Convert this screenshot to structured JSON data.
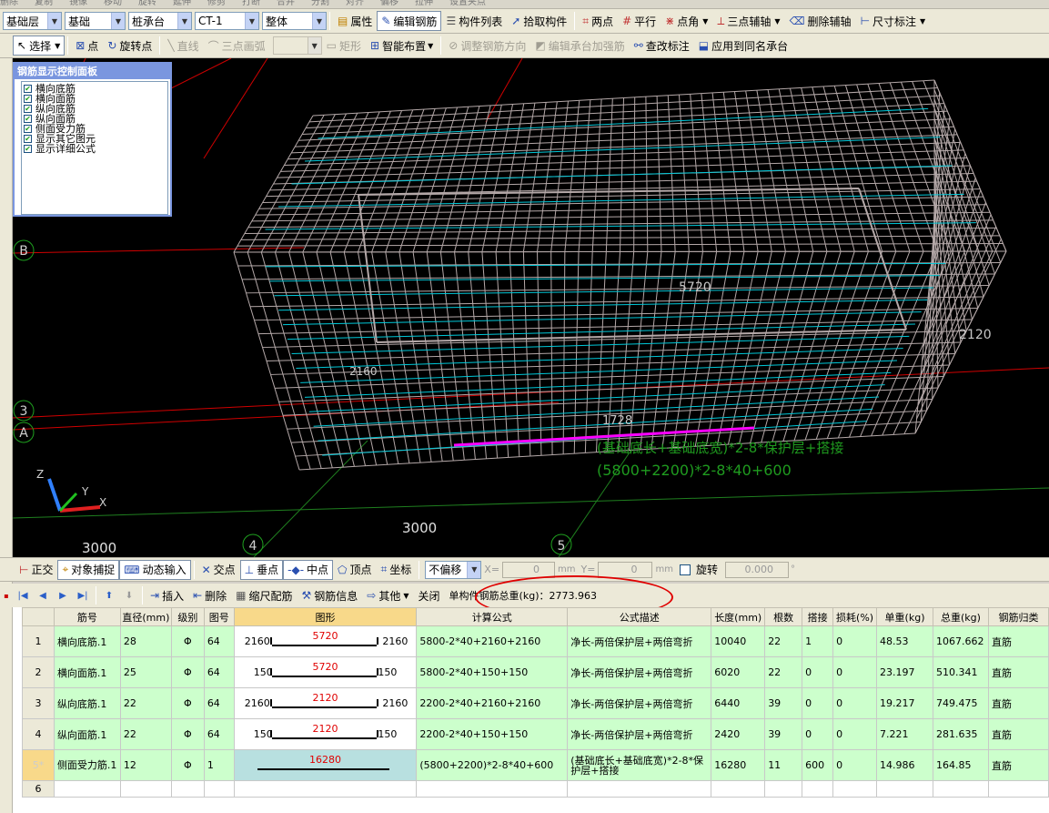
{
  "top_strip": [
    "删除",
    "复制",
    "镜像",
    "移动",
    "旋转",
    "延伸",
    "修剪",
    "打断",
    "合并",
    "分割",
    "对齐",
    "偏移",
    "拉伸",
    "设置夹点"
  ],
  "toolbar1": {
    "floor_select": "基础层",
    "category_select": "基础",
    "type_select": "桩承台",
    "element_select": "CT-1",
    "unit_select": "整体",
    "properties": "属性",
    "edit_rebar": "编辑钢筋",
    "element_list": "构件列表",
    "pick_element": "拾取构件",
    "two_points": "两点",
    "parallel": "平行",
    "point_angle": "点角",
    "three_point_axis": "三点辅轴",
    "delete_aux": "删除辅轴",
    "dimension": "尺寸标注"
  },
  "toolbar2": {
    "select": "选择",
    "point": "点",
    "rotate_point": "旋转点",
    "line": "直线",
    "arc3": "三点画弧",
    "rect": "矩形",
    "smart_layout": "智能布置",
    "adjust_direction": "调整钢筋方向",
    "edit_reinforce": "编辑承台加强筋",
    "check_label": "查改标注",
    "apply_same": "应用到同名承台"
  },
  "rebar_panel": {
    "title": "钢筋显示控制面板",
    "items": [
      "横向底筋",
      "横向面筋",
      "纵向底筋",
      "纵向面筋",
      "侧面受力筋",
      "显示其它图元",
      "显示详细公式"
    ]
  },
  "viewport": {
    "axis_B": "B",
    "axis_3": "3",
    "axis_A": "A",
    "axis_4": "4",
    "axis_5": "5",
    "dim_3000_a": "3000",
    "dim_3000_b": "3000",
    "dim_5720": "5720",
    "dim_2120_side": "2120",
    "dim_2160": "2160",
    "dim_1728": "1728",
    "formula_desc": "(基础底长+基础底宽)*2-8*保护层+搭接",
    "formula_calc": "(5800+2200)*2-8*40+600",
    "axis_z": "Z",
    "axis_y": "Y",
    "axis_x": "X"
  },
  "snapbar": {
    "ortho": "正交",
    "object_snap": "对象捕捉",
    "dynamic_input": "动态输入",
    "intersection": "交点",
    "perpendicular": "垂点",
    "midpoint": "中点",
    "vertex": "顶点",
    "coordinate": "坐标",
    "offset_mode": "不偏移",
    "x_label": "X=",
    "x_value": "0",
    "mm1": "mm",
    "y_label": "Y=",
    "y_value": "0",
    "mm2": "mm",
    "rotate": "旋转",
    "rotate_value": "0.000"
  },
  "navbar": {
    "insert": "插入",
    "delete": "删除",
    "scale_rebar": "缩尺配筋",
    "rebar_info": "钢筋信息",
    "other": "其他",
    "close": "关闭",
    "total_weight": "单构件钢筋总重(kg)：2773.963"
  },
  "table": {
    "headers": [
      "筋号",
      "直径(mm)",
      "级别",
      "图号",
      "图形",
      "计算公式",
      "公式描述",
      "长度(mm)",
      "根数",
      "搭接",
      "损耗(%)",
      "单重(kg)",
      "总重(kg)",
      "钢筋归类"
    ],
    "rows": [
      {
        "num": "1",
        "name": "横向底筋.1",
        "dia": "28",
        "grade": "Φ",
        "fig": "64",
        "sl": "2160",
        "sm": "5720",
        "sr": "2160",
        "formula": "5800-2*40+2160+2160",
        "desc": "净长-两倍保护层+两倍弯折",
        "len": "10040",
        "count": "22",
        "lap": "1",
        "loss": "0",
        "unit_w": "48.53",
        "total_w": "1067.662",
        "cat": "直筋"
      },
      {
        "num": "2",
        "name": "横向面筋.1",
        "dia": "25",
        "grade": "Φ",
        "fig": "64",
        "sl": "150",
        "sm": "5720",
        "sr": "150",
        "formula": "5800-2*40+150+150",
        "desc": "净长-两倍保护层+两倍弯折",
        "len": "6020",
        "count": "22",
        "lap": "0",
        "loss": "0",
        "unit_w": "23.197",
        "total_w": "510.341",
        "cat": "直筋"
      },
      {
        "num": "3",
        "name": "纵向底筋.1",
        "dia": "22",
        "grade": "Φ",
        "fig": "64",
        "sl": "2160",
        "sm": "2120",
        "sr": "2160",
        "formula": "2200-2*40+2160+2160",
        "desc": "净长-两倍保护层+两倍弯折",
        "len": "6440",
        "count": "39",
        "lap": "0",
        "loss": "0",
        "unit_w": "19.217",
        "total_w": "749.475",
        "cat": "直筋"
      },
      {
        "num": "4",
        "name": "纵向面筋.1",
        "dia": "22",
        "grade": "Φ",
        "fig": "64",
        "sl": "150",
        "sm": "2120",
        "sr": "150",
        "formula": "2200-2*40+150+150",
        "desc": "净长-两倍保护层+两倍弯折",
        "len": "2420",
        "count": "39",
        "lap": "0",
        "loss": "0",
        "unit_w": "7.221",
        "total_w": "281.635",
        "cat": "直筋"
      },
      {
        "num": "5*",
        "name": "侧面受力筋.1",
        "dia": "12",
        "grade": "Φ",
        "fig": "1",
        "sl": "",
        "sm": "16280",
        "sr": "",
        "formula": "(5800+2200)*2-8*40+600",
        "desc": "(基础底长+基础底宽)*2-8*保护层+搭接",
        "len": "16280",
        "count": "11",
        "lap": "600",
        "loss": "0",
        "unit_w": "14.986",
        "total_w": "164.85",
        "cat": "直筋"
      },
      {
        "num": "6"
      }
    ]
  },
  "colors": {
    "viewport_bg": "#000000",
    "mesh": "#b4a8a8",
    "rebar_cyan": "#00c8d8",
    "highlight_magenta": "#ff00ff",
    "annotation_green": "#1f9b1f",
    "axis_red": "#d00000",
    "row_green": "#ccffcc"
  }
}
